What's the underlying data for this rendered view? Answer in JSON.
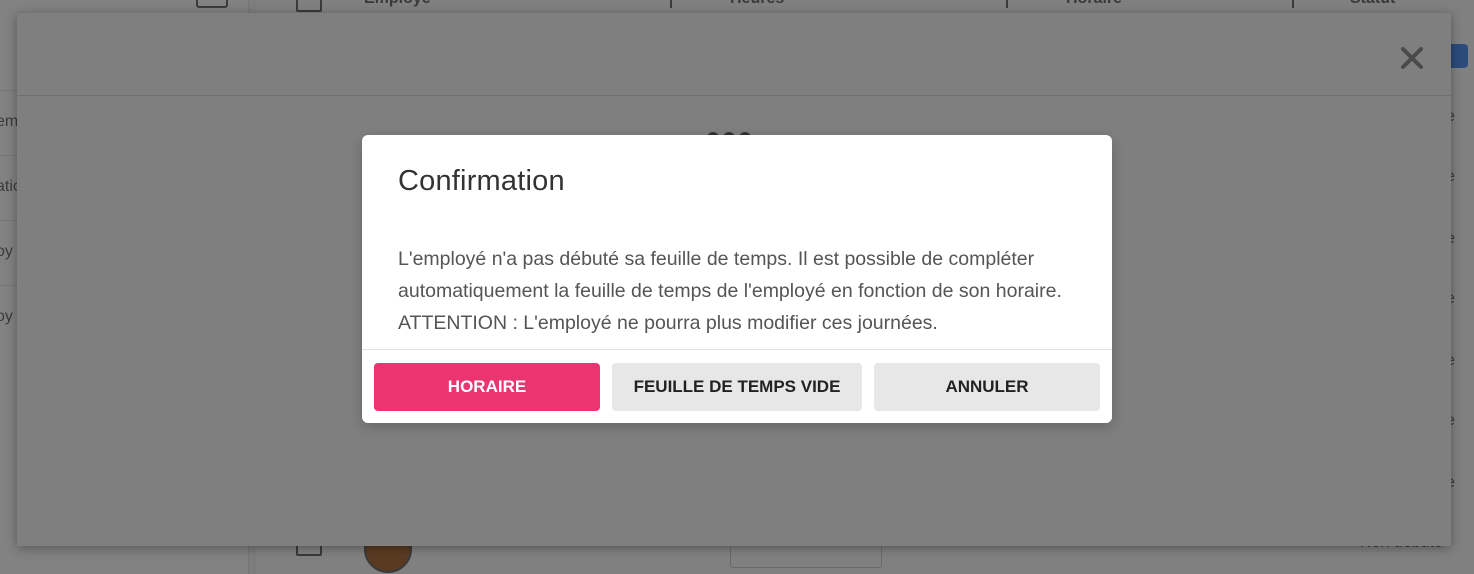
{
  "background": {
    "table_headers": [
      "Employé",
      "Heures",
      "Horaire",
      "Statut"
    ],
    "left_fragments": [
      "em",
      "atic",
      "oy",
      "oy"
    ],
    "status_fragments": [
      "e",
      "e",
      "e",
      "e",
      "e",
      "e",
      "e"
    ],
    "bottom_status": "Non débuté"
  },
  "dialog": {
    "title": "Confirmation",
    "message": "L'employé n'a pas débuté sa feuille de temps. Il est possible de compléter automatiquement la feuille de temps de l'employé en fonction de son horaire. ATTENTION : L'employé ne pourra plus modifier ces journées.",
    "buttons": {
      "schedule": "HORAIRE",
      "empty_timesheet": "FEUILLE DE TEMPS VIDE",
      "cancel": "ANNULER"
    }
  },
  "colors": {
    "primary": "#ec3471",
    "secondary": "#e7e7e7",
    "overlay": "#7f7f7f"
  },
  "icons": {
    "close": "close-icon",
    "loading": "loading-spinner-icon"
  }
}
